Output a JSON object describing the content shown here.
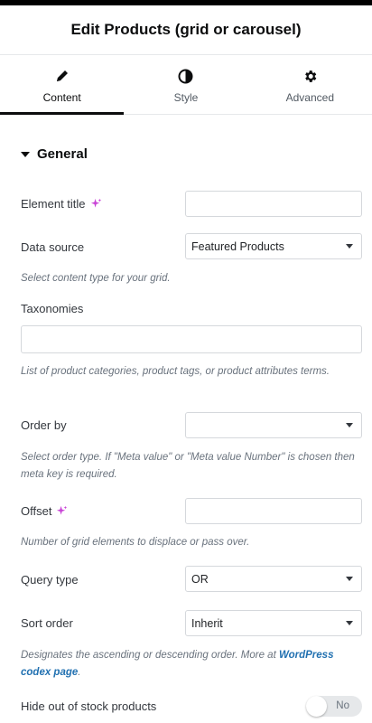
{
  "header": {
    "title": "Edit Products (grid or carousel)"
  },
  "tabs": [
    {
      "label": "Content",
      "icon": "pencil-icon",
      "active": true
    },
    {
      "label": "Style",
      "icon": "contrast-icon",
      "active": false
    },
    {
      "label": "Advanced",
      "icon": "gear-icon",
      "active": false
    }
  ],
  "section": {
    "title": "General"
  },
  "fields": {
    "element_title": {
      "label": "Element title",
      "value": ""
    },
    "data_source": {
      "label": "Data source",
      "value": "Featured Products",
      "help": "Select content type for your grid."
    },
    "taxonomies": {
      "label": "Taxonomies",
      "value": "",
      "help": "List of product categories, product tags, or product attributes terms."
    },
    "order_by": {
      "label": "Order by",
      "value": "",
      "help": "Select order type. If \"Meta value\" or \"Meta value Number\" is chosen then meta key is required."
    },
    "offset": {
      "label": "Offset",
      "value": "",
      "help": "Number of grid elements to displace or pass over."
    },
    "query_type": {
      "label": "Query type",
      "value": "OR"
    },
    "sort_order": {
      "label": "Sort order",
      "value": "Inherit",
      "help_prefix": "Designates the ascending or descending order. More at ",
      "help_link": "WordPress codex page",
      "help_suffix": "."
    },
    "hide_out_of_stock": {
      "label": "Hide out of stock products",
      "toggle_label": "No",
      "checked": false
    }
  },
  "colors": {
    "ai_accent": "#c843d6",
    "link": "#2271b1"
  }
}
